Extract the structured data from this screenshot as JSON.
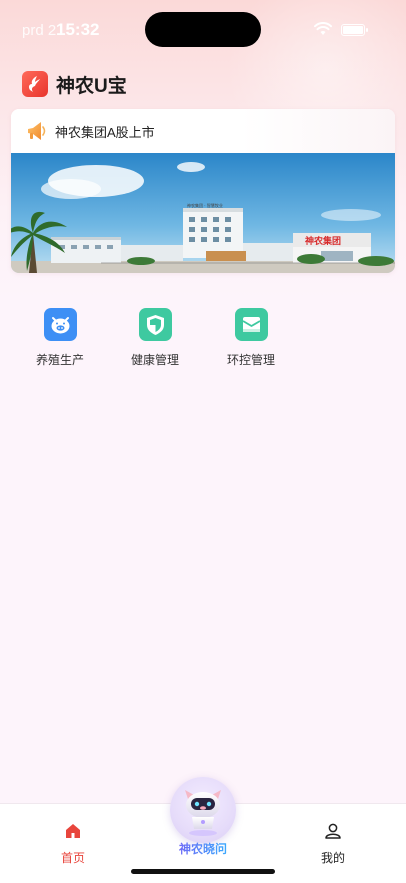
{
  "status_bar": {
    "env": "prd 2",
    "time": "15:32"
  },
  "header": {
    "app_title": "神农U宝",
    "logo_icon": "brand-logo-icon"
  },
  "notice": {
    "text": "神农集团A股上市",
    "icon": "horn-icon"
  },
  "banner": {
    "building_sign": "神农集团",
    "roof_sign": "神农集团 · 智慧牧业"
  },
  "quick_actions": [
    {
      "label": "养殖生产",
      "icon": "pig-icon",
      "color": "#3d8ff5"
    },
    {
      "label": "健康管理",
      "icon": "shield-icon",
      "color": "#3ec9a0"
    },
    {
      "label": "环控管理",
      "icon": "envelope-icon",
      "color": "#3ec9a0"
    }
  ],
  "bottom_nav": {
    "home": "首页",
    "ai": "神农晓问",
    "mine": "我的"
  },
  "colors": {
    "accent": "#e8453c",
    "ai_gradient_start": "#7a5cf5",
    "ai_gradient_end": "#2fb7ff"
  }
}
